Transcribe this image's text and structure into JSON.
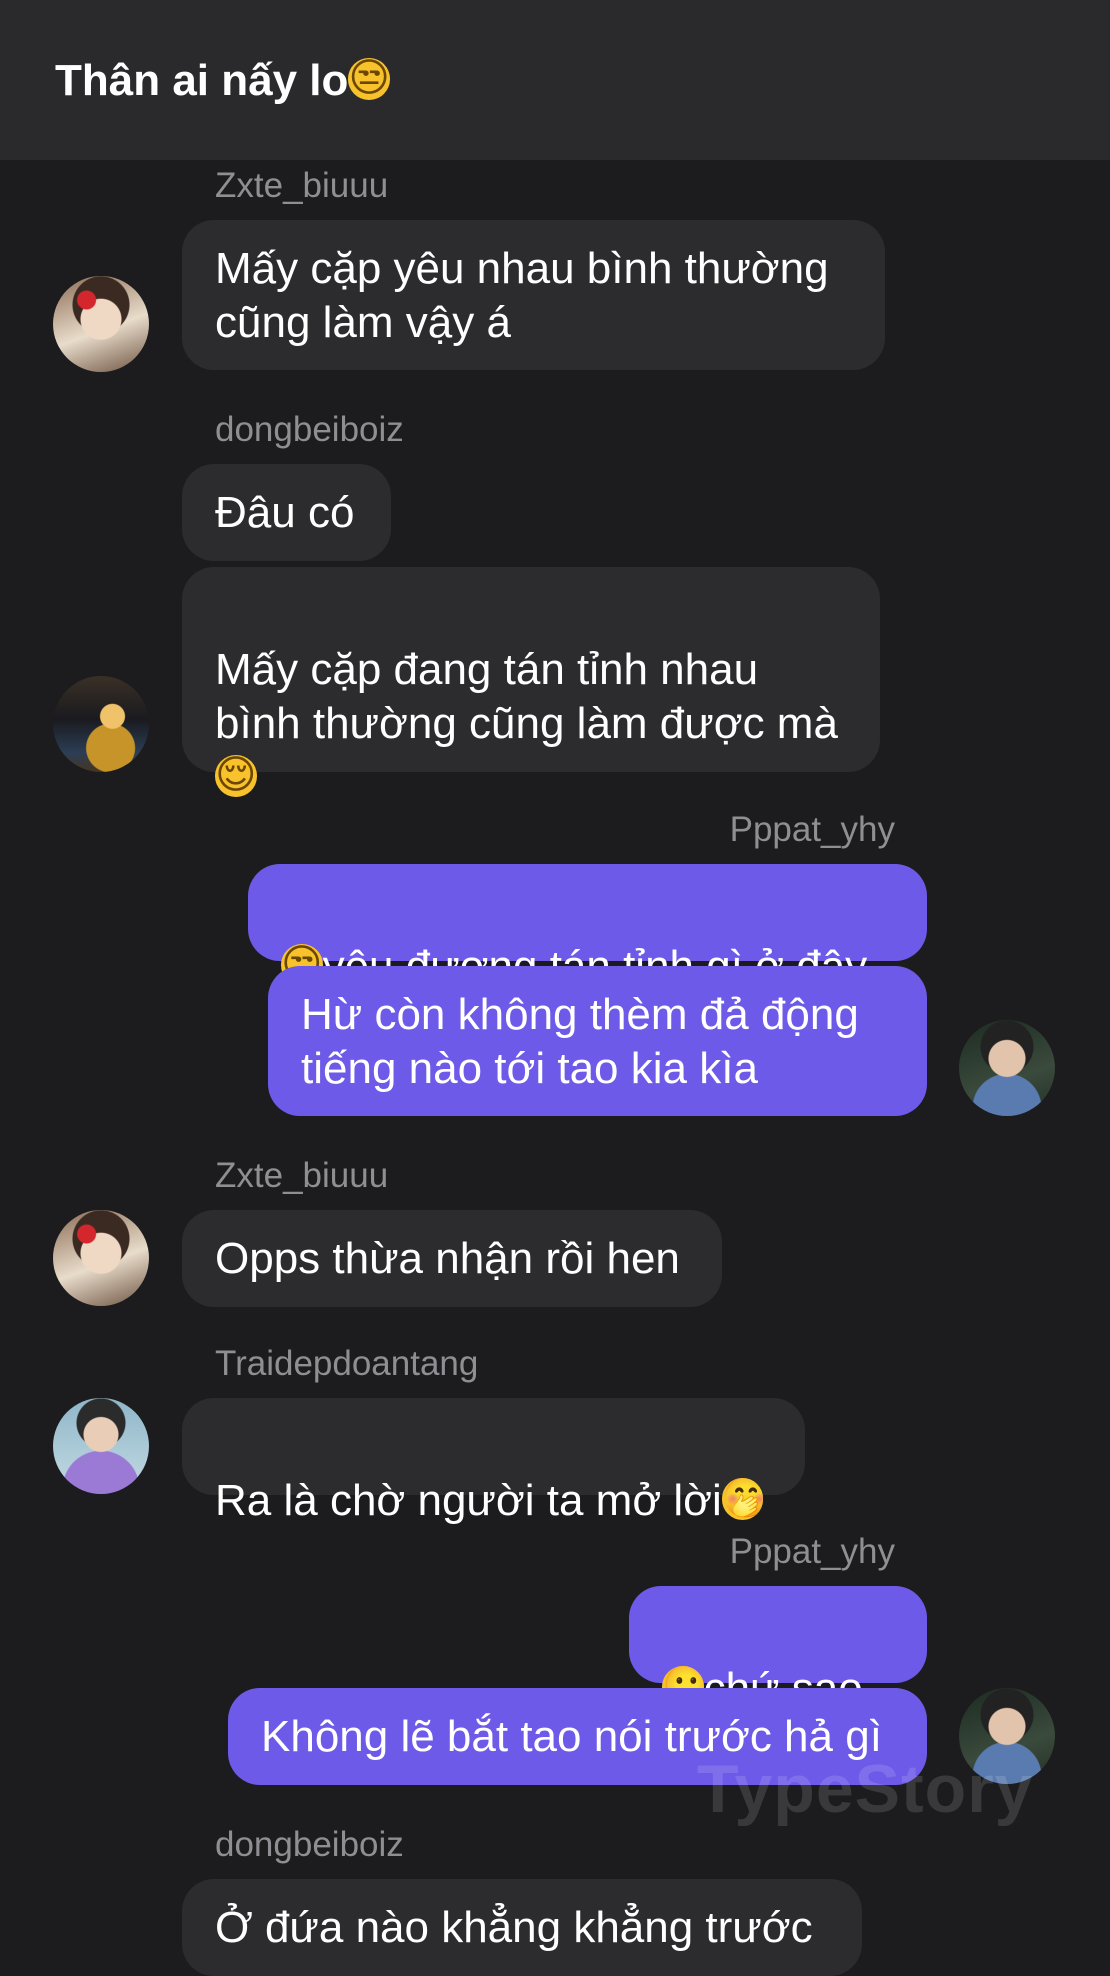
{
  "header": {
    "title": "Thân ai nấy lo",
    "title_emoji": "😒",
    "title_emoji_name": "unamused-face"
  },
  "messages": [
    {
      "sender": "Zxte_biuuu",
      "direction": "incoming",
      "bubbles": [
        {
          "text": "Mấy cặp yêu nhau bình thường\ncũng làm vậy á"
        }
      ]
    },
    {
      "sender": "dongbeiboiz",
      "direction": "incoming",
      "bubbles": [
        {
          "text": "Đâu có"
        },
        {
          "text": "Mấy cặp đang tán tỉnh nhau\nbình thường cũng làm được mà\n",
          "emoji": "😌",
          "emoji_name": "relieved-face"
        }
      ]
    },
    {
      "sender": "Pppat_yhy",
      "direction": "outgoing",
      "bubbles": [
        {
          "emoji": "😒",
          "emoji_name": "unamused-face",
          "text": "yêu đương tán tỉnh gì ở đây"
        },
        {
          "text": "Hừ còn không thèm đả động\ntiếng nào tới tao kia kìa"
        }
      ]
    },
    {
      "sender": "Zxte_biuuu",
      "direction": "incoming",
      "bubbles": [
        {
          "text": "Opps thừa nhận rồi hen"
        }
      ]
    },
    {
      "sender": "Traidepdoantang",
      "direction": "incoming",
      "bubbles": [
        {
          "text": "Ra là chờ người ta mở lời",
          "emoji": "🤭",
          "emoji_name": "face-with-hand-over-mouth"
        }
      ]
    },
    {
      "sender": "Pppat_yhy",
      "direction": "outgoing",
      "bubbles": [
        {
          "emoji": "🙂",
          "emoji_name": "slightly-smiling-face",
          "text": "chứ sao"
        },
        {
          "text": "Không lẽ bắt tao nói trước hả gì"
        }
      ]
    },
    {
      "sender": "dongbeiboiz",
      "direction": "incoming",
      "bubbles": [
        {
          "text": "Ở đứa nào khẳng khẳng trước"
        }
      ]
    }
  ],
  "watermark": "TypeStory",
  "colors": {
    "background": "#1c1c1e",
    "header": "#2a2a2d",
    "incoming_bubble": "#2c2c2e",
    "outgoing_bubble": "#6d5ae8",
    "sender_name": "#8e8e93"
  }
}
